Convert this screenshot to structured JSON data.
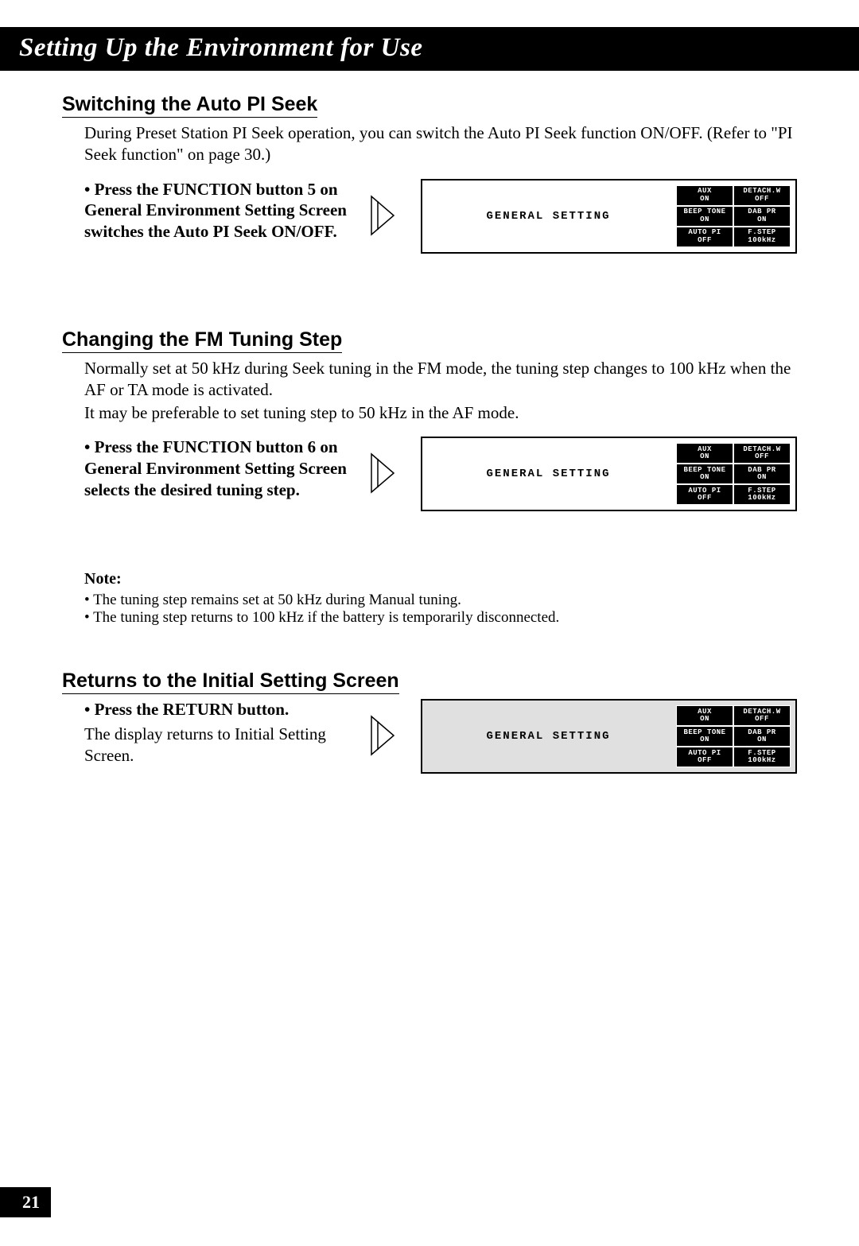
{
  "chapter_title": "Setting Up the Environment for Use",
  "page_number": "21",
  "section1": {
    "title": "Switching the Auto PI Seek",
    "body": "During Preset Station PI Seek operation, you can switch the Auto PI Seek function ON/OFF. (Refer to \"PI Seek function\" on page 30.)",
    "step": "Press the FUNCTION button 5 on General Environment Setting Screen switches the Auto PI Seek ON/OFF."
  },
  "section2": {
    "title": "Changing the FM Tuning Step",
    "body1": "Normally set at 50 kHz during Seek tuning in the FM mode, the tuning step changes to 100 kHz when the AF or TA mode is activated.",
    "body2": "It may be preferable to set tuning step to 50 kHz in the AF mode.",
    "step": "Press the FUNCTION button 6 on General Environment Setting Screen selects the desired tuning step.",
    "note_heading": "Note:",
    "notes": [
      "The tuning step remains set at 50 kHz during Manual tuning.",
      "The tuning step returns to 100 kHz if the battery is temporarily disconnected."
    ]
  },
  "section3": {
    "title": "Returns to the Initial Setting Screen",
    "step": "Press the RETURN button.",
    "substep": "The display returns to Initial Setting Screen."
  },
  "screen": {
    "label": "GENERAL SETTING",
    "cells": [
      {
        "l1": "AUX",
        "l2": "ON"
      },
      {
        "l1": "DETACH.W",
        "l2": "OFF"
      },
      {
        "l1": "BEEP TONE",
        "l2": "ON"
      },
      {
        "l1": "DAB PR",
        "l2": "ON"
      },
      {
        "l1": "AUTO PI",
        "l2": "OFF"
      },
      {
        "l1": "F.STEP",
        "l2": "100kHz"
      }
    ]
  }
}
